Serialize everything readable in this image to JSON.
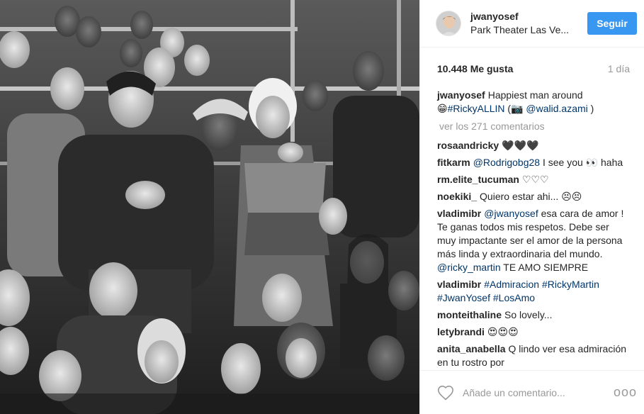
{
  "header": {
    "username": "jwanyosef",
    "location": "Park Theater Las Ve...",
    "follow_label": "Seguir"
  },
  "post": {
    "likes": "10.448 Me gusta",
    "age": "1 día",
    "caption": {
      "user": "jwanyosef",
      "text1": "Happiest man around",
      "emoji1": "😁",
      "tag1": "#RickyALLIN",
      "text2": " (",
      "emoji2": "📷",
      "mention": "@walid.azami",
      "text3": " )"
    },
    "view_all": "ver los 271 comentarios"
  },
  "comments": [
    {
      "user": "rosaandricky",
      "parts": [
        {
          "t": "🖤🖤🖤",
          "link": false
        }
      ]
    },
    {
      "user": "fitkarm",
      "parts": [
        {
          "t": "@Rodrigobg28",
          "link": true
        },
        {
          "t": " I see you 👀 haha",
          "link": false
        }
      ]
    },
    {
      "user": "rm.elite_tucuman",
      "parts": [
        {
          "t": "♡♡♡",
          "link": false
        }
      ]
    },
    {
      "user": "noekiki_",
      "parts": [
        {
          "t": "Quiero estar ahi... 😣😣",
          "link": false
        }
      ]
    },
    {
      "user": "vladimibr",
      "parts": [
        {
          "t": "@jwanyosef",
          "link": true
        },
        {
          "t": " esa cara de amor ! Te ganas todos mis respetos. Debe ser muy impactante ser el amor de la persona más linda y extraordinaria del mundo. ",
          "link": false
        },
        {
          "t": "@ricky_martin",
          "link": true
        },
        {
          "t": " TE AMO SIEMPRE",
          "link": false
        }
      ]
    },
    {
      "user": "vladimibr",
      "parts": [
        {
          "t": "#Admiracion #RickyMartin #JwanYosef #LosAmo",
          "link": true
        }
      ]
    },
    {
      "user": "monteithaline",
      "parts": [
        {
          "t": "So lovely...",
          "link": false
        }
      ]
    },
    {
      "user": "letybrandi",
      "parts": [
        {
          "t": "😍😍😍",
          "link": false
        }
      ]
    },
    {
      "user": "anita_anabella",
      "parts": [
        {
          "t": "Q lindo ver esa admiración en tu rostro por",
          "link": false
        }
      ]
    }
  ],
  "footer": {
    "placeholder": "Añade un comentario...",
    "more_label": "ooo"
  },
  "icons": {
    "heart": "heart-icon",
    "more": "more-options-icon"
  },
  "colors": {
    "follow": "#3897f0",
    "link": "#003569",
    "muted": "#999999"
  }
}
